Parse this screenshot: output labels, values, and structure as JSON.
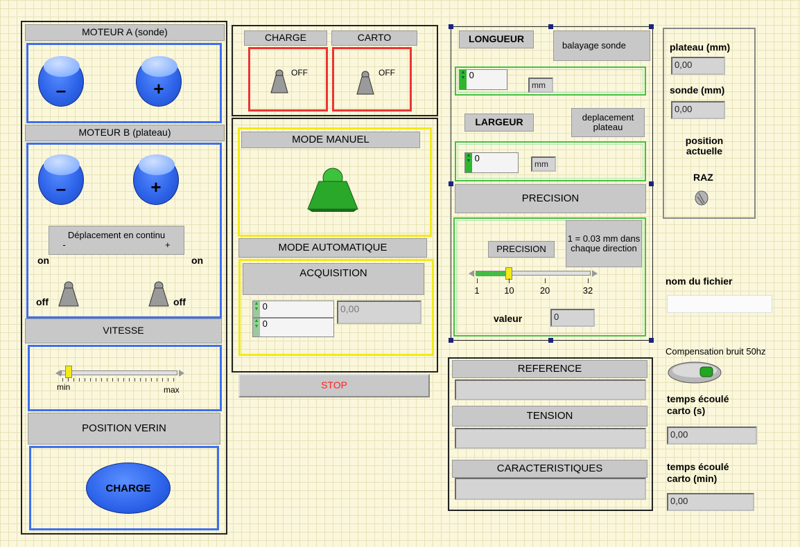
{
  "moteur_a": {
    "title": "MOTEUR A (sonde)",
    "minus": "–",
    "plus": "+"
  },
  "moteur_b": {
    "title": "MOTEUR B (plateau)",
    "minus": "–",
    "plus": "+",
    "continu_label": "Déplacement en continu",
    "continu_minus": "-",
    "continu_plus": "+",
    "on_left": "on",
    "on_right": "on",
    "off_left": "off",
    "off_right": "off"
  },
  "vitesse": {
    "title": "VITESSE",
    "min": "min",
    "max": "max",
    "level": 0.05
  },
  "verin": {
    "title": "POSITION VERIN",
    "button": "CHARGE"
  },
  "charge_carto": {
    "charge_label": "CHARGE",
    "charge_state": "OFF",
    "carto_label": "CARTO",
    "carto_state": "OFF"
  },
  "mode_manuel": {
    "title": "MODE MANUEL"
  },
  "mode_auto": {
    "title": "MODE AUTOMATIQUE",
    "acquisition": "ACQUISITION",
    "value1": "0",
    "value2": "0",
    "result": "0,00"
  },
  "stop": {
    "label": "STOP"
  },
  "longueur": {
    "title": "LONGUEUR",
    "desc": "balayage sonde",
    "value": "0",
    "unit": "mm"
  },
  "largeur": {
    "title": "LARGEUR",
    "desc": "deplacement plateau",
    "value": "0",
    "unit": "mm"
  },
  "precision": {
    "title": "PRECISION",
    "inner_label": "PRECISION",
    "note": "1 = 0.03 mm dans chaque direction",
    "ticks": [
      "1",
      "10",
      "20",
      "32"
    ],
    "slider_value": 10,
    "valeur_label": "valeur",
    "valeur": "0"
  },
  "reference": {
    "title": "REFERENCE",
    "value": ""
  },
  "tension": {
    "title": "TENSION",
    "value": ""
  },
  "caracteristiques": {
    "title": "CARACTERISTIQUES",
    "value": ""
  },
  "position": {
    "plateau_label": "plateau (mm)",
    "plateau_value": "0,00",
    "sonde_label": "sonde (mm)",
    "sonde_value": "0,00",
    "caption": "position actuelle",
    "raz": "RAZ"
  },
  "fichier": {
    "label": "nom du fichier",
    "value": ""
  },
  "compensation": {
    "label": "Compensation bruit 50hz"
  },
  "temps_s": {
    "label": "temps écoulé carto (s)",
    "value": "0,00"
  },
  "temps_min": {
    "label": "temps écoulé carto (min)",
    "value": "0,00"
  },
  "colors": {
    "blue_frame": "#3d6ff0",
    "red_frame": "#ee3333",
    "yellow_frame": "#f2ea18",
    "green_frame": "#44c044",
    "stop_text": "#ff2020",
    "manual_button": "#22aa22"
  }
}
